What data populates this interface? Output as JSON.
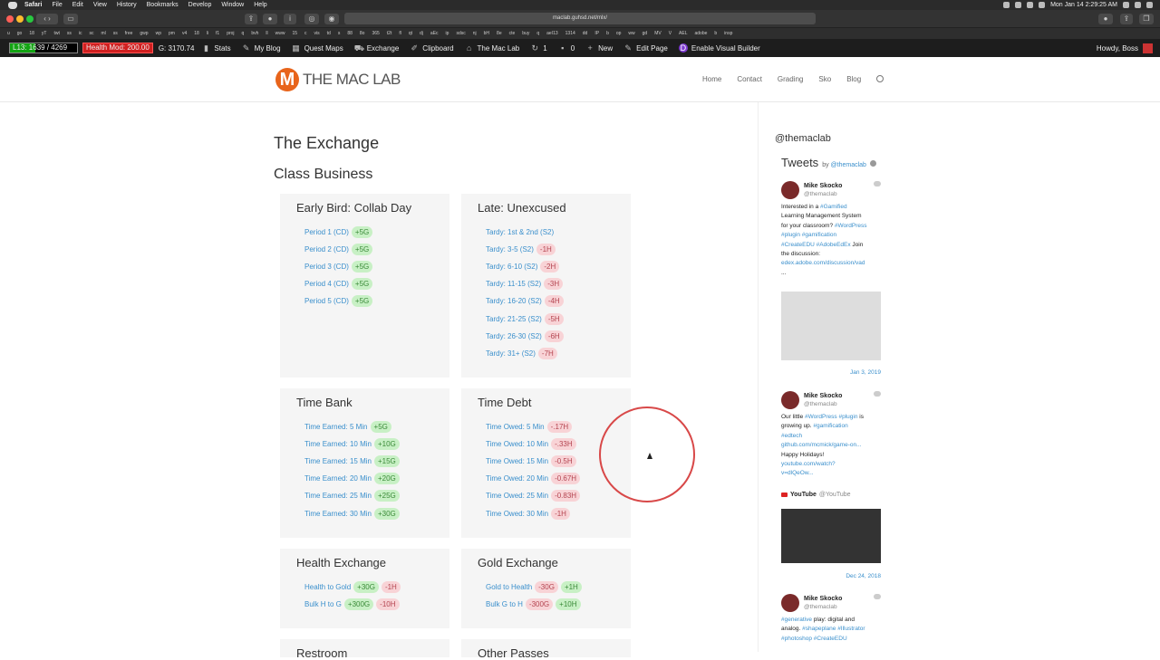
{
  "menubar": {
    "app": "Safari",
    "items": [
      "File",
      "Edit",
      "View",
      "History",
      "Bookmarks",
      "Develop",
      "Window",
      "Help"
    ],
    "clock": "Mon Jan 14  2:29:25 AM"
  },
  "browser": {
    "url": "maclab.guhsd.net/mlx/"
  },
  "favorites": [
    "u",
    "go",
    "18",
    "yT",
    "twt",
    "ss",
    "ic",
    "sc",
    "ml",
    "ss",
    "free",
    "gwp",
    "wp",
    "pm",
    "v4",
    "18",
    "li",
    "f1",
    "proj",
    "q",
    "bvh",
    "ll",
    "www",
    "15",
    "c",
    "vis",
    "td",
    "s",
    "88",
    "8o",
    "365",
    "t2t",
    "fl",
    "qt",
    "dj",
    "aEc",
    "ip",
    "sdsc",
    "nj",
    "bH",
    "8e",
    "cte",
    "buy",
    "q",
    "aeI13",
    "1314",
    "dd",
    "IP",
    "b",
    "op",
    "ww",
    "gd",
    "MV",
    "V",
    "AEL",
    "adobe",
    "b",
    "insp"
  ],
  "wpbar": {
    "level": "L13: 1639 / 4269",
    "level_progress": 0.38,
    "health": "Health Mod: 200.00",
    "gold": "G: 3170.74",
    "items": [
      {
        "icon": "stats-icon",
        "label": "Stats"
      },
      {
        "icon": "pin-icon",
        "label": "My Blog"
      },
      {
        "icon": "map-icon",
        "label": "Quest Maps"
      },
      {
        "icon": "cart-icon",
        "label": "Exchange"
      },
      {
        "icon": "clipboard-icon",
        "label": "Clipboard"
      },
      {
        "icon": "home-icon",
        "label": "The Mac Lab"
      },
      {
        "icon": "update-icon",
        "label": "1"
      },
      {
        "icon": "comment-icon",
        "label": "0"
      },
      {
        "icon": "plus-icon",
        "label": "New"
      },
      {
        "icon": "edit-icon",
        "label": "Edit Page"
      },
      {
        "icon": "divi-icon",
        "label": "Enable Visual Builder"
      }
    ],
    "howdy": "Howdy, Boss"
  },
  "site": {
    "logo_letter": "M",
    "logo_text": "THE MAC LAB",
    "nav": [
      "Home",
      "Contact",
      "Grading",
      "Sko",
      "Blog"
    ]
  },
  "page": {
    "title": "The Exchange",
    "subtitle": "Class Business"
  },
  "cards": [
    {
      "title": "Early Bird: Collab Day",
      "rows": [
        {
          "label": "Period 1 (CD)",
          "badges": [
            {
              "t": "+5G",
              "k": "pos"
            }
          ]
        },
        {
          "label": "Period 2 (CD)",
          "badges": [
            {
              "t": "+5G",
              "k": "pos"
            }
          ]
        },
        {
          "label": "Period 3 (CD)",
          "badges": [
            {
              "t": "+5G",
              "k": "pos"
            }
          ]
        },
        {
          "label": "Period 4 (CD)",
          "badges": [
            {
              "t": "+5G",
              "k": "pos"
            }
          ]
        },
        {
          "label": "Period 5 (CD)",
          "badges": [
            {
              "t": "+5G",
              "k": "pos"
            }
          ]
        }
      ]
    },
    {
      "title": "Late: Unexcused",
      "rows": [
        {
          "label": "Tardy: 1st & 2nd (S2)",
          "badges": []
        },
        {
          "label": "Tardy: 3-5 (S2)",
          "badges": [
            {
              "t": "-1H",
              "k": "neg"
            }
          ]
        },
        {
          "label": "Tardy: 6-10 (S2)",
          "badges": [
            {
              "t": "-2H",
              "k": "neg"
            }
          ]
        },
        {
          "label": "Tardy: 11-15 (S2)",
          "badges": [
            {
              "t": "-3H",
              "k": "neg"
            }
          ]
        },
        {
          "label": "Tardy: 16-20 (S2)",
          "badges": [
            {
              "t": "-4H",
              "k": "neg"
            }
          ]
        },
        {
          "label": "Tardy: 21-25 (S2)",
          "badges": [
            {
              "t": "-5H",
              "k": "neg"
            }
          ]
        },
        {
          "label": "Tardy: 26-30 (S2)",
          "badges": [
            {
              "t": "-6H",
              "k": "neg"
            }
          ]
        },
        {
          "label": "Tardy: 31+ (S2)",
          "badges": [
            {
              "t": "-7H",
              "k": "neg"
            }
          ]
        }
      ]
    },
    {
      "title": "Time Bank",
      "rows": [
        {
          "label": "Time Earned: 5 Min",
          "badges": [
            {
              "t": "+5G",
              "k": "pos"
            }
          ]
        },
        {
          "label": "Time Earned: 10 Min",
          "badges": [
            {
              "t": "+10G",
              "k": "pos"
            }
          ]
        },
        {
          "label": "Time Earned: 15 Min",
          "badges": [
            {
              "t": "+15G",
              "k": "pos"
            }
          ]
        },
        {
          "label": "Time Earned: 20 Min",
          "badges": [
            {
              "t": "+20G",
              "k": "pos"
            }
          ]
        },
        {
          "label": "Time Earned: 25 Min",
          "badges": [
            {
              "t": "+25G",
              "k": "pos"
            }
          ]
        },
        {
          "label": "Time Earned: 30 Min",
          "badges": [
            {
              "t": "+30G",
              "k": "pos"
            }
          ]
        }
      ]
    },
    {
      "title": "Time Debt",
      "rows": [
        {
          "label": "Time Owed: 5 Min",
          "badges": [
            {
              "t": "-.17H",
              "k": "neg"
            }
          ]
        },
        {
          "label": "Time Owed: 10 Min",
          "badges": [
            {
              "t": "-.33H",
              "k": "neg"
            }
          ]
        },
        {
          "label": "Time Owed: 15 Min",
          "badges": [
            {
              "t": "-0.5H",
              "k": "neg"
            }
          ]
        },
        {
          "label": "Time Owed: 20 Min",
          "badges": [
            {
              "t": "-0.67H",
              "k": "neg"
            }
          ]
        },
        {
          "label": "Time Owed: 25 Min",
          "badges": [
            {
              "t": "-0.83H",
              "k": "neg"
            }
          ]
        },
        {
          "label": "Time Owed: 30 Min",
          "badges": [
            {
              "t": "-1H",
              "k": "neg"
            }
          ]
        }
      ]
    },
    {
      "title": "Health Exchange",
      "rows": [
        {
          "label": "Health to Gold",
          "badges": [
            {
              "t": "+30G",
              "k": "pos"
            },
            {
              "t": "-1H",
              "k": "neg"
            }
          ]
        },
        {
          "label": "Bulk H to G",
          "badges": [
            {
              "t": "+300G",
              "k": "pos"
            },
            {
              "t": "-10H",
              "k": "neg"
            }
          ]
        }
      ]
    },
    {
      "title": "Gold Exchange",
      "rows": [
        {
          "label": "Gold to Health",
          "badges": [
            {
              "t": "-30G",
              "k": "neg"
            },
            {
              "t": "+1H",
              "k": "pos"
            }
          ]
        },
        {
          "label": "Bulk G to H",
          "badges": [
            {
              "t": "-300G",
              "k": "neg"
            },
            {
              "t": "+10H",
              "k": "pos"
            }
          ]
        }
      ]
    },
    {
      "title": "Restroom",
      "rows": []
    },
    {
      "title": "Other Passes",
      "rows": []
    }
  ],
  "twitter": {
    "handle": "@themaclab",
    "header": "Tweets",
    "by": "by",
    "by_handle": "@themaclab",
    "tweets": [
      {
        "name": "Mike Skocko",
        "handle": "@themaclab",
        "lines": [
          [
            "Interested in a ",
            [
              "#Gamified"
            ]
          ],
          [
            "Learning Management System"
          ],
          [
            "for your classroom? ",
            [
              "#WordPress"
            ]
          ],
          [
            [
              "#plugin"
            ],
            " ",
            [
              "#gamification"
            ]
          ],
          [
            [
              "#CreateEDU"
            ],
            " ",
            [
              "#AdobeEdEx"
            ],
            " Join"
          ],
          [
            "the discussion:"
          ],
          [
            [
              "edex.adobe.com/discussion/vad"
            ]
          ],
          [
            "..."
          ]
        ],
        "date": "Jan 3, 2019"
      },
      {
        "name": "Mike Skocko",
        "handle": "@themaclab",
        "lines": [
          [
            "Our little ",
            [
              "#WordPress"
            ],
            " ",
            [
              "#plugin"
            ],
            " is"
          ],
          [
            "growing up. ",
            [
              "#gamification"
            ]
          ],
          [
            [
              "#edtech"
            ]
          ],
          [
            [
              "github.com/mcmick/game-on..."
            ]
          ],
          [
            "Happy Holidays!"
          ],
          [
            [
              "youtube.com/watch?"
            ]
          ],
          [
            [
              "v=dlQeOw..."
            ]
          ]
        ],
        "yt_name": "YouTube",
        "yt_handle": "@YouTube",
        "date": "Dec 24, 2018"
      },
      {
        "name": "Mike Skocko",
        "handle": "@themaclab",
        "lines": [
          [
            [
              "#generative"
            ],
            " play: digital and"
          ],
          [
            "analog. ",
            [
              "#shapeplane"
            ],
            " ",
            [
              "#Illustrator"
            ]
          ],
          [
            [
              "#photoshop"
            ],
            " ",
            [
              "#CreateEDU"
            ]
          ]
        ]
      }
    ]
  }
}
